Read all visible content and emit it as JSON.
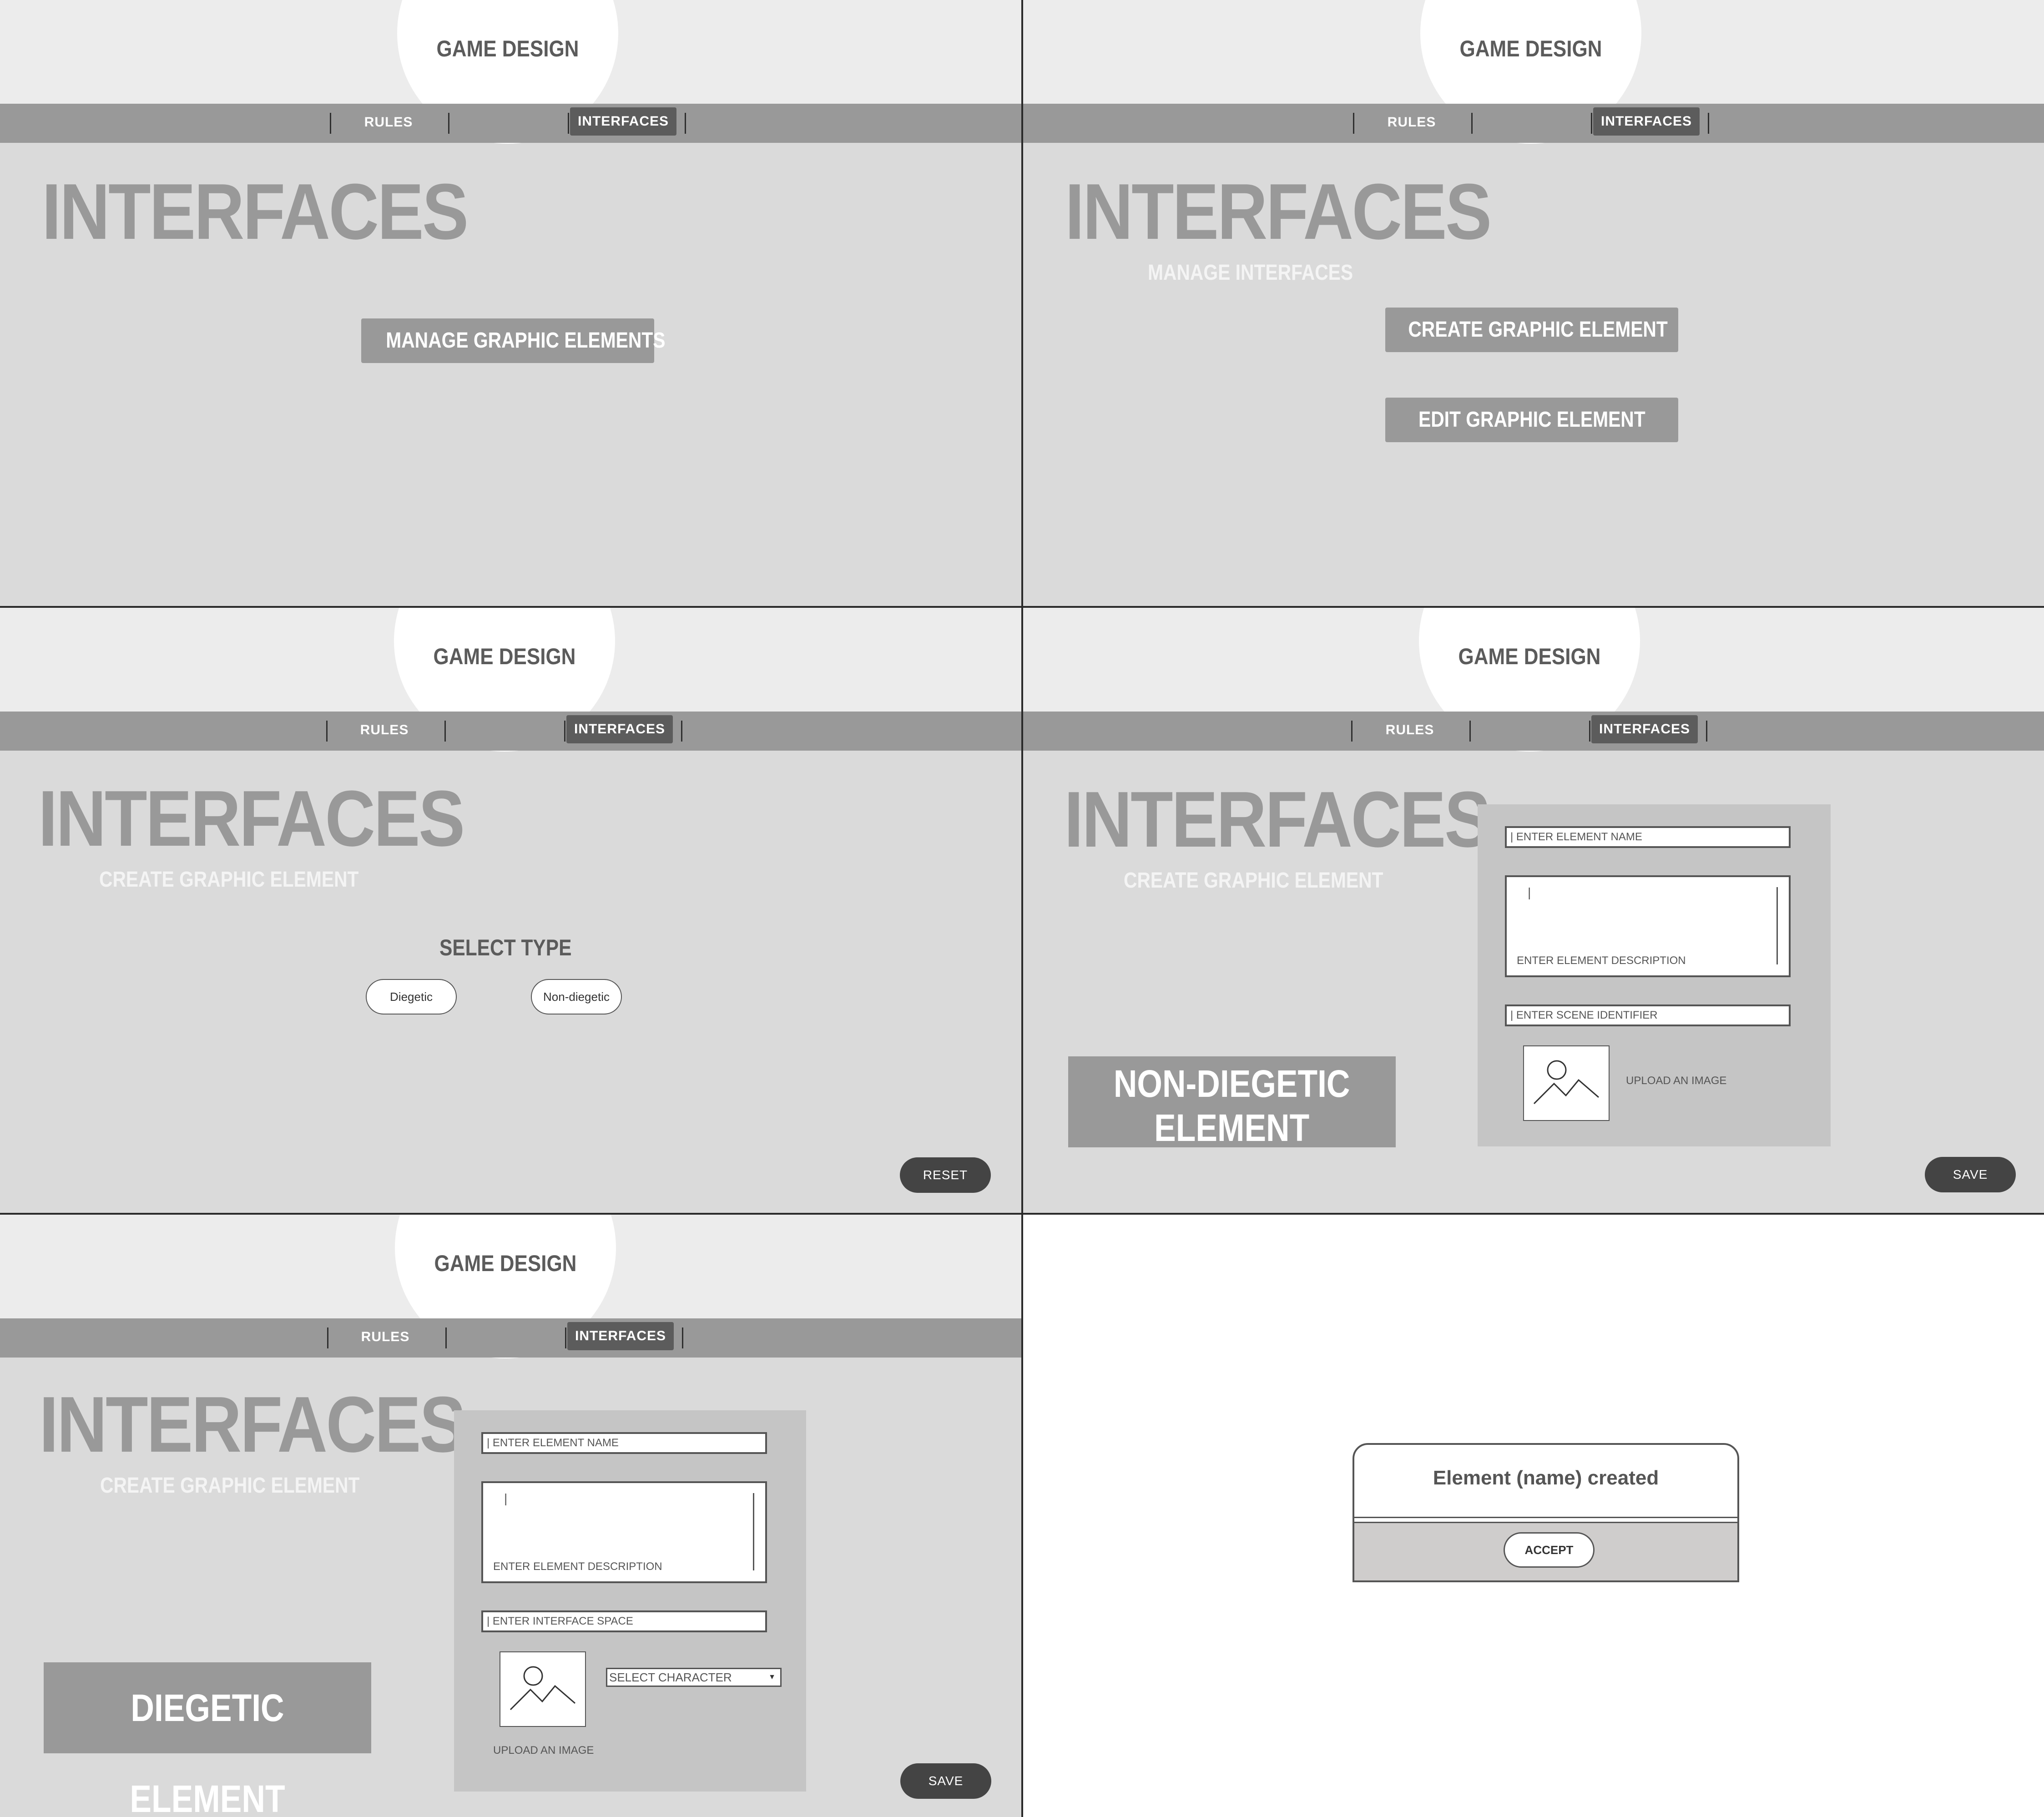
{
  "header": {
    "title": "GAME DESIGN"
  },
  "nav": {
    "rules": "RULES",
    "interfaces": "INTERFACES"
  },
  "page_title": "INTERFACES",
  "screen1": {
    "manage_button": "MANAGE GRAPHIC ELEMENTS"
  },
  "screen2": {
    "subtitle": "MANAGE INTERFACES",
    "create_button": "CREATE GRAPHIC ELEMENT",
    "edit_button": "EDIT GRAPHIC ELEMENT"
  },
  "screen3": {
    "subtitle": "CREATE GRAPHIC ELEMENT",
    "select_type": "SELECT TYPE",
    "diegetic": "Diegetic",
    "non_diegetic": "Non-diegetic",
    "reset": "RESET"
  },
  "screen4": {
    "subtitle": "CREATE GRAPHIC ELEMENT",
    "type_label_line1": "NON-DIEGETIC",
    "type_label_line2": "ELEMENT",
    "name_placeholder": "| ENTER ELEMENT NAME",
    "description_placeholder": "ENTER ELEMENT DESCRIPTION",
    "cursor": "|",
    "scene_placeholder": "| ENTER SCENE IDENTIFIER",
    "upload": "UPLOAD AN IMAGE",
    "save": "SAVE"
  },
  "screen5": {
    "subtitle": "CREATE GRAPHIC ELEMENT",
    "type_label": "DIEGETIC ELEMENT",
    "name_placeholder": "| ENTER ELEMENT NAME",
    "description_placeholder": "ENTER ELEMENT DESCRIPTION",
    "cursor": "|",
    "space_placeholder": "| ENTER INTERFACE SPACE",
    "character_select": "SELECT CHARACTER",
    "upload": "UPLOAD AN IMAGE",
    "save": "SAVE"
  },
  "dialog": {
    "message": "Element (name) created",
    "accept": "ACCEPT"
  }
}
